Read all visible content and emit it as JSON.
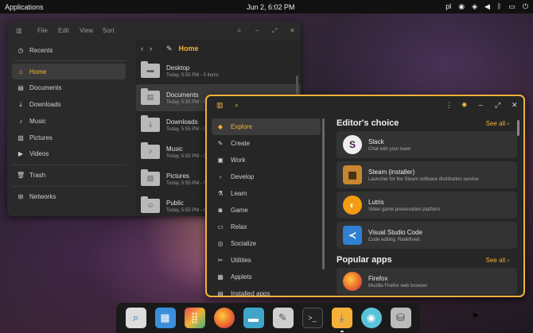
{
  "topbar": {
    "applications": "Applications",
    "clock": "Jun 2, 6:02 PM",
    "lang": "pl",
    "tray_icons": [
      "network-icon",
      "wifi-icon",
      "volume-icon",
      "bluetooth-icon",
      "battery-icon",
      "power-icon"
    ]
  },
  "file_manager": {
    "menu": [
      "File",
      "Edit",
      "View",
      "Sort"
    ],
    "path": "Home",
    "sidebar": [
      {
        "label": "Recents",
        "icon": "clock-icon"
      },
      {
        "label": "Home",
        "icon": "home-icon",
        "active": true
      },
      {
        "label": "Documents",
        "icon": "document-icon"
      },
      {
        "label": "Downloads",
        "icon": "download-icon"
      },
      {
        "label": "Music",
        "icon": "music-icon"
      },
      {
        "label": "Pictures",
        "icon": "picture-icon"
      },
      {
        "label": "Videos",
        "icon": "video-icon"
      },
      {
        "label": "Trash",
        "icon": "trash-icon"
      },
      {
        "label": "Networks",
        "icon": "network-icon"
      }
    ],
    "files": [
      {
        "name": "Desktop",
        "meta": "Today, 5:55 PM - 0 items"
      },
      {
        "name": "Documents",
        "meta": "Today, 5:55 PM - 0 items"
      },
      {
        "name": "Downloads",
        "meta": "Today, 5:55 PM - 0 items"
      },
      {
        "name": "Music",
        "meta": "Today, 5:55 PM - 0 items"
      },
      {
        "name": "Pictures",
        "meta": "Today, 5:55 PM - 0 items"
      },
      {
        "name": "Public",
        "meta": "Today, 5:55 PM - 0 items"
      }
    ]
  },
  "store": {
    "categories": [
      {
        "label": "Explore",
        "active": true
      },
      {
        "label": "Create"
      },
      {
        "label": "Work"
      },
      {
        "label": "Develop"
      },
      {
        "label": "Learn"
      },
      {
        "label": "Game"
      },
      {
        "label": "Relax"
      },
      {
        "label": "Socialize"
      },
      {
        "label": "Utilities"
      },
      {
        "label": "Applets"
      },
      {
        "label": "Installed apps"
      }
    ],
    "editors_choice": {
      "title": "Editor's choice",
      "see_all": "See all",
      "apps": [
        {
          "name": "Slack",
          "desc": "Chat with your team",
          "color": "#e8e8e8"
        },
        {
          "name": "Steam (installer)",
          "desc": "Launcher for the Steam software distribution service",
          "color": "#c8862f"
        },
        {
          "name": "Lutris",
          "desc": "Video game preservation platform",
          "color": "#f39c12"
        },
        {
          "name": "Visual Studio Code",
          "desc": "Code editing. Redefined.",
          "color": "#2f80d0"
        }
      ]
    },
    "popular": {
      "title": "Popular apps",
      "see_all": "See all",
      "apps": [
        {
          "name": "Firefox",
          "desc": "Mozilla Firefox web browser",
          "color": "#e8612c"
        }
      ]
    }
  },
  "dock": [
    "app-search",
    "tiling-windows",
    "app-grid",
    "firefox",
    "files",
    "text-editor",
    "terminal",
    "app-store",
    "screenshot",
    "installer"
  ]
}
